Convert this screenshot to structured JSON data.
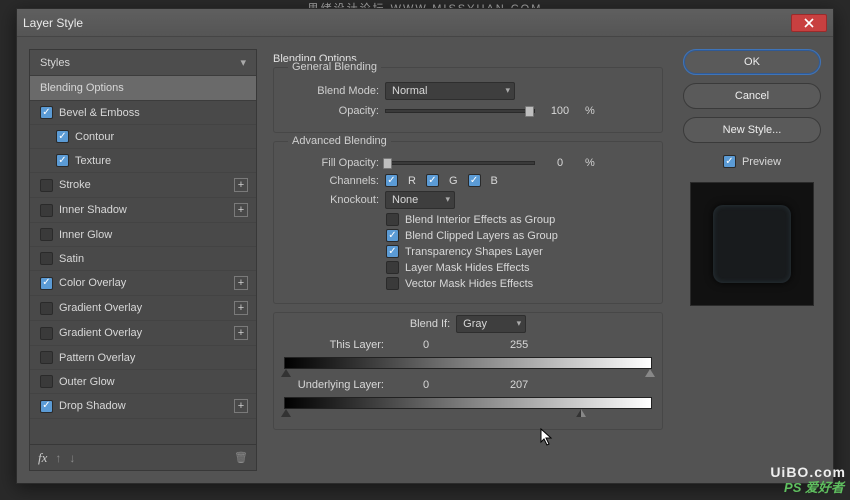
{
  "watermark_top": "思绪设计论坛  WWW.MISSYUAN.COM",
  "watermark_right": "PS 爱好者",
  "watermark_bottom": "UiBO.com",
  "dialog": {
    "title": "Layer Style"
  },
  "buttons": {
    "ok": "OK",
    "cancel": "Cancel",
    "new_style": "New Style...",
    "preview": "Preview"
  },
  "styles": {
    "header": "Styles",
    "blending_options": "Blending Options",
    "bevel_emboss": "Bevel & Emboss",
    "contour": "Contour",
    "texture": "Texture",
    "stroke": "Stroke",
    "inner_shadow": "Inner Shadow",
    "inner_glow": "Inner Glow",
    "satin": "Satin",
    "color_overlay": "Color Overlay",
    "gradient_overlay1": "Gradient Overlay",
    "gradient_overlay2": "Gradient Overlay",
    "pattern_overlay": "Pattern Overlay",
    "outer_glow": "Outer Glow",
    "drop_shadow": "Drop Shadow"
  },
  "panel": {
    "title": "Blending Options",
    "general": {
      "legend": "General Blending",
      "blend_mode_label": "Blend Mode:",
      "blend_mode_value": "Normal",
      "opacity_label": "Opacity:",
      "opacity_value": "100",
      "opacity_unit": "%"
    },
    "advanced": {
      "legend": "Advanced Blending",
      "fill_opacity_label": "Fill Opacity:",
      "fill_opacity_value": "0",
      "fill_opacity_unit": "%",
      "channels_label": "Channels:",
      "ch_r": "R",
      "ch_g": "G",
      "ch_b": "B",
      "knockout_label": "Knockout:",
      "knockout_value": "None",
      "opt_interior": "Blend Interior Effects as Group",
      "opt_clipped": "Blend Clipped Layers as Group",
      "opt_transparency": "Transparency Shapes Layer",
      "opt_layer_mask": "Layer Mask Hides Effects",
      "opt_vector_mask": "Vector Mask Hides Effects"
    },
    "blendif": {
      "label": "Blend If:",
      "value": "Gray",
      "this_label": "This Layer:",
      "this_low": "0",
      "this_high": "255",
      "under_label": "Underlying Layer:",
      "under_low": "0",
      "under_high": "207"
    }
  }
}
